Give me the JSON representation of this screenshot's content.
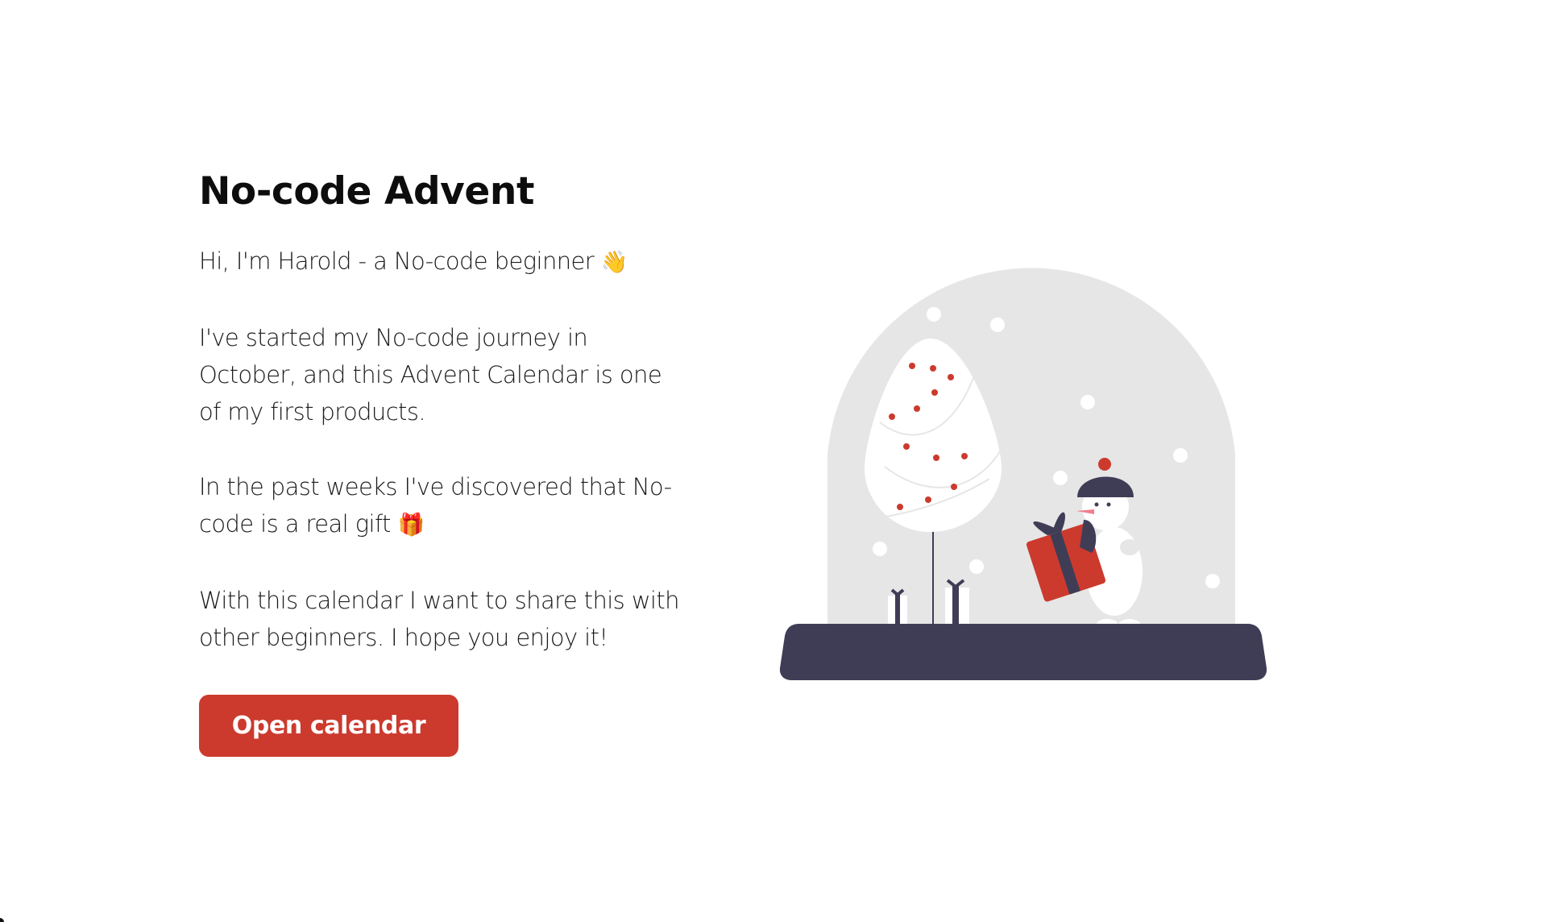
{
  "page": {
    "title": "No-code Advent",
    "intro": "Hi, I'm Harold - a No-code beginner",
    "intro_emoji": "👋",
    "paragraph_1": "I've started my No-code journey in October, and this Advent Calendar is one of my first products.",
    "paragraph_2": "In the past weeks I've discovered that No-code is a real gift",
    "paragraph_2_emoji": "🎁",
    "paragraph_3": "With this calendar I want to share this with other beginners. I hope you enjoy it!",
    "cta_label": "Open calendar"
  },
  "colors": {
    "accent": "#cc3a2e",
    "dark": "#3f3d56",
    "globe": "#e6e6e6",
    "snow": "#ffffff"
  },
  "illustration": {
    "icon": "snow-globe-snowman-icon"
  }
}
